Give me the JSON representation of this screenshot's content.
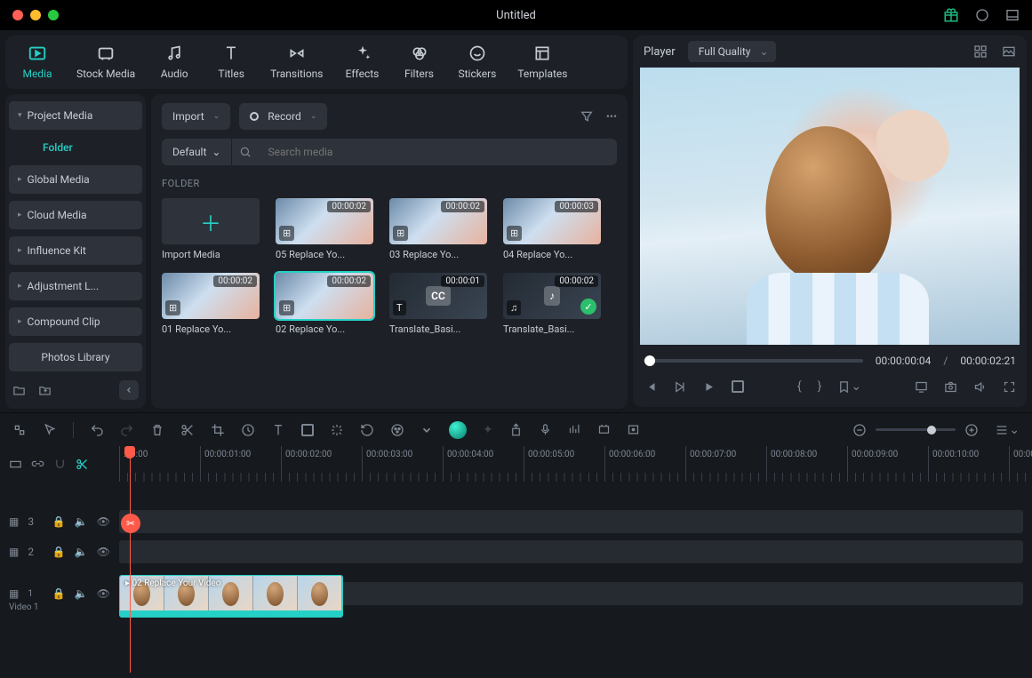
{
  "title": "Untitled",
  "topTabs": [
    {
      "id": "media",
      "label": "Media",
      "icon": "media-icon"
    },
    {
      "id": "stock",
      "label": "Stock Media",
      "icon": "cloud-icon"
    },
    {
      "id": "audio",
      "label": "Audio",
      "icon": "music-icon"
    },
    {
      "id": "titles",
      "label": "Titles",
      "icon": "text-icon"
    },
    {
      "id": "transitions",
      "label": "Transitions",
      "icon": "transition-icon"
    },
    {
      "id": "effects",
      "label": "Effects",
      "icon": "sparkle-icon"
    },
    {
      "id": "filters",
      "label": "Filters",
      "icon": "filter-icon"
    },
    {
      "id": "stickers",
      "label": "Stickers",
      "icon": "sticker-icon"
    },
    {
      "id": "templates",
      "label": "Templates",
      "icon": "template-icon"
    }
  ],
  "activeTopTab": "media",
  "sidebar": {
    "items": [
      {
        "label": "Project Media",
        "caret": "down",
        "sub": "Folder"
      },
      {
        "label": "Global Media",
        "caret": "right"
      },
      {
        "label": "Cloud Media",
        "caret": "right"
      },
      {
        "label": "Influence Kit",
        "caret": "right"
      },
      {
        "label": "Adjustment L...",
        "caret": "right"
      },
      {
        "label": "Compound Clip",
        "caret": "right"
      },
      {
        "label": "Photos Library",
        "caret": "none"
      }
    ]
  },
  "browser": {
    "import": "Import",
    "record": "Record",
    "sort": "Default",
    "searchPlaceholder": "Search media",
    "sectionLabel": "FOLDER",
    "media": [
      {
        "kind": "add",
        "label": "Import Media"
      },
      {
        "kind": "clip",
        "label": "05 Replace Yo...",
        "dur": "00:00:02"
      },
      {
        "kind": "clip",
        "label": "03 Replace Yo...",
        "dur": "00:00:02"
      },
      {
        "kind": "clip",
        "label": "04 Replace Yo...",
        "dur": "00:00:03"
      },
      {
        "kind": "clip",
        "label": "01 Replace Yo...",
        "dur": "00:00:02"
      },
      {
        "kind": "clip",
        "label": "02 Replace Yo...",
        "dur": "00:00:02",
        "selected": true
      },
      {
        "kind": "asset",
        "label": "Translate_Basi...",
        "dur": "00:00:01",
        "cc": true,
        "icon": "T"
      },
      {
        "kind": "asset",
        "label": "Translate_Basi...",
        "dur": "00:00:02",
        "music": true,
        "check": true
      }
    ]
  },
  "player": {
    "label": "Player",
    "quality": "Full Quality",
    "currentTime": "00:00:00:04",
    "duration": "00:00:02:21"
  },
  "ruler": {
    "ticks": [
      ":00:00",
      "00:00:01:00",
      "00:00:02:00",
      "00:00:03:00",
      "00:00:04:00",
      "00:00:05:00",
      "00:00:06:00",
      "00:00:07:00",
      "00:00:08:00",
      "00:00:09:00",
      "00:00:10:00",
      "00:00:11:"
    ]
  },
  "tracks": [
    {
      "name": "3",
      "type": "fx"
    },
    {
      "name": "2",
      "type": "fx"
    },
    {
      "name": "1",
      "type": "video",
      "title": "Video 1",
      "clipLabel": "02 Replace Your Video"
    }
  ]
}
